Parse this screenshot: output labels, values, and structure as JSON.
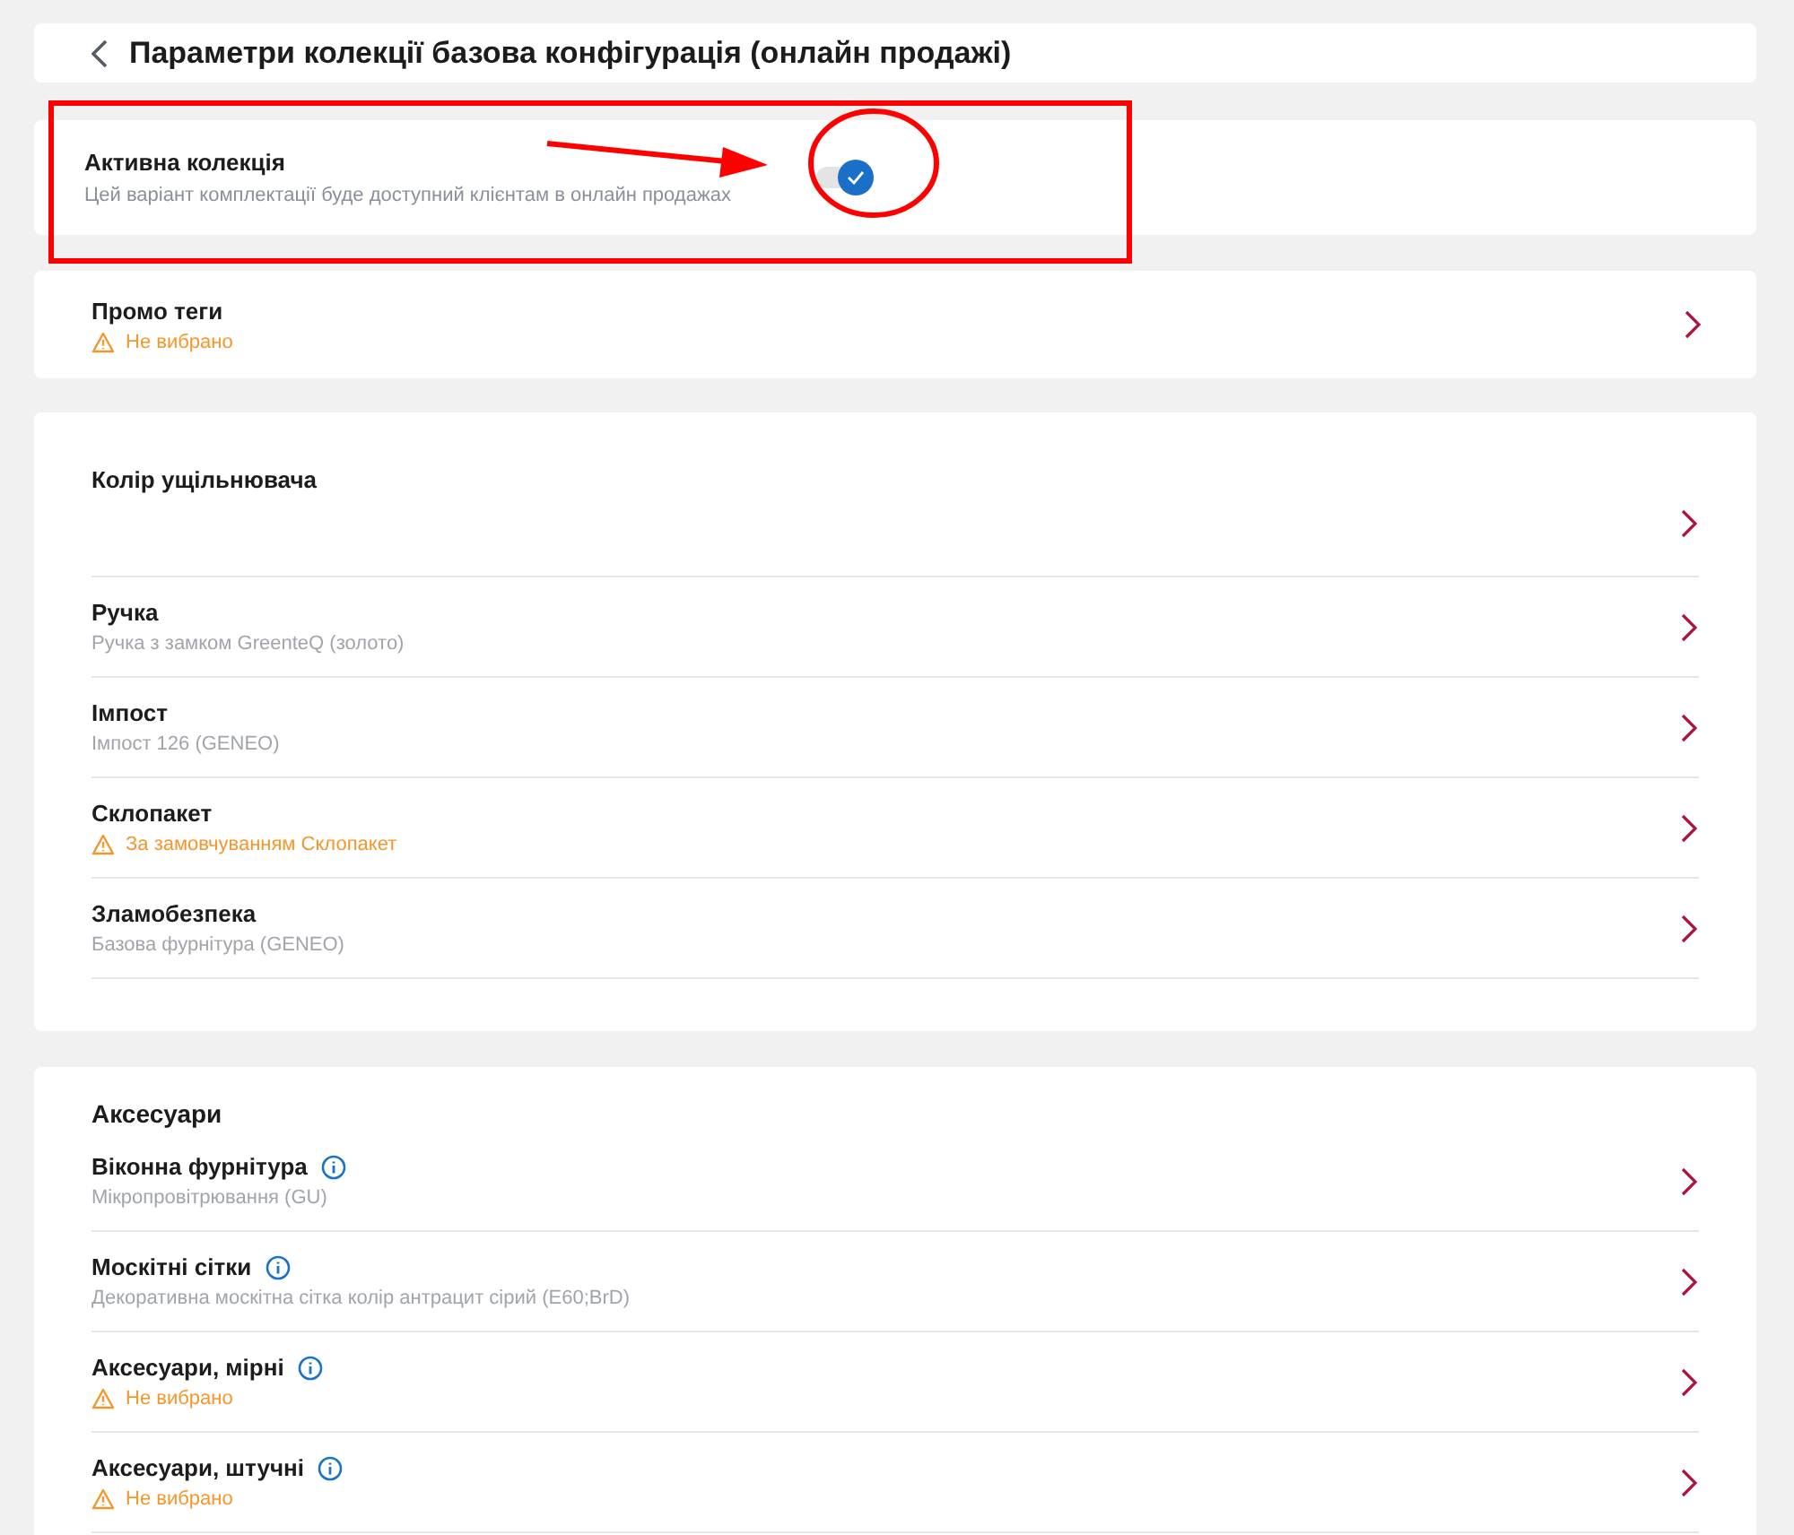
{
  "header": {
    "title": "Параметри колекції базова конфігурація (онлайн продажі)"
  },
  "active_collection": {
    "title": "Активна колекція",
    "description": "Цей варіант комплектації буде доступний клієнтам в онлайн продажах",
    "on": true
  },
  "promo": {
    "title": "Промо теги",
    "status": "Не вибрано",
    "kind": "warning"
  },
  "options": {
    "items": [
      {
        "title": "Колір ущільнювача"
      },
      {
        "title": "Ручка",
        "status": "Ручка з замком GreenteQ (золото)",
        "kind": "value"
      },
      {
        "title": "Імпост",
        "status": "Імпост 126 (GENEO)",
        "kind": "value"
      },
      {
        "title": "Склопакет",
        "status": "За замовчуванням Склопакет",
        "kind": "warning"
      },
      {
        "title": "Зламобезпека",
        "status": "Базова фурнітура (GENEO)",
        "kind": "value"
      }
    ]
  },
  "accessories": {
    "title": "Аксесуари",
    "items": [
      {
        "title": "Віконна фурнітура",
        "info": true,
        "status": "Мікропровітрювання (GU)",
        "kind": "value"
      },
      {
        "title": "Москітні сітки",
        "info": true,
        "status": "Декоративна москітна сітка колір антрацит сірий (E60;BrD)",
        "kind": "value"
      },
      {
        "title": "Аксесуари, мірні",
        "info": true,
        "status": "Не вибрано",
        "kind": "warning"
      },
      {
        "title": "Аксесуари, штучні",
        "info": true,
        "status": "Не вибрано",
        "kind": "warning"
      }
    ]
  }
}
